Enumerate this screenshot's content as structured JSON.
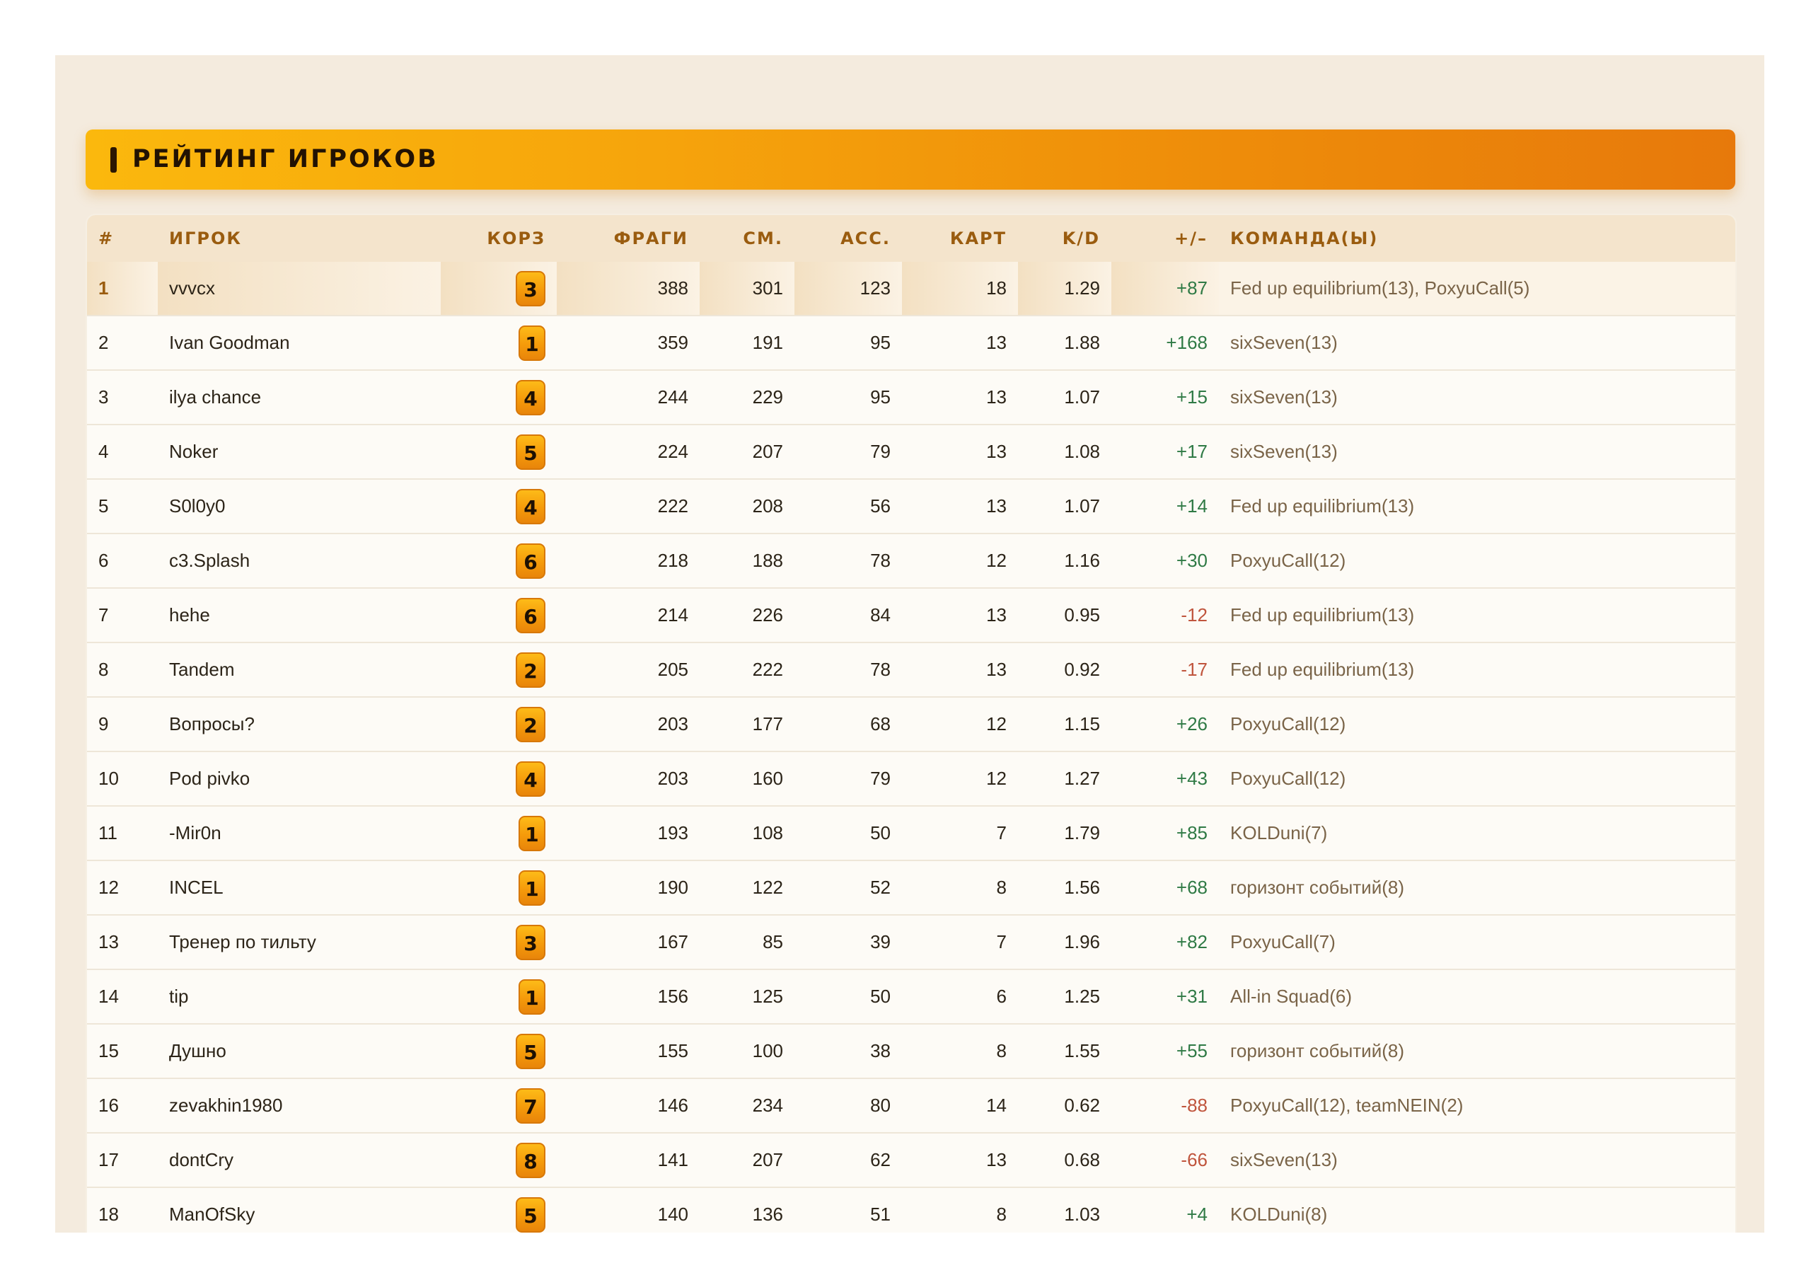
{
  "title": "РЕЙТИНГ ИГРОКОВ",
  "headers": {
    "rank": "#",
    "player": "ИГРОК",
    "basket": "КОРЗ",
    "kills": "ФРАГИ",
    "deaths": "СМ.",
    "assists": "АСС.",
    "maps": "КАРТ",
    "kd": "K/D",
    "diff": "+/–",
    "teams": "КОМАНДА(Ы)"
  },
  "colors": {
    "accent": "#f5a00b",
    "positive": "#2f7a45",
    "negative": "#c0553d",
    "header_text": "#9a5c0f"
  },
  "rows": [
    {
      "rank": "1",
      "player": "vvvcx",
      "basket": "3",
      "kills": "388",
      "deaths": "301",
      "assists": "123",
      "maps": "18",
      "kd": "1.29",
      "diff": "+87",
      "teams": "Fed up equilibrium(13), PoxyuCall(5)"
    },
    {
      "rank": "2",
      "player": "Ivan Goodman",
      "basket": "1",
      "kills": "359",
      "deaths": "191",
      "assists": "95",
      "maps": "13",
      "kd": "1.88",
      "diff": "+168",
      "teams": "sixSeven(13)"
    },
    {
      "rank": "3",
      "player": "ilya chance",
      "basket": "4",
      "kills": "244",
      "deaths": "229",
      "assists": "95",
      "maps": "13",
      "kd": "1.07",
      "diff": "+15",
      "teams": "sixSeven(13)"
    },
    {
      "rank": "4",
      "player": "Noker",
      "basket": "5",
      "kills": "224",
      "deaths": "207",
      "assists": "79",
      "maps": "13",
      "kd": "1.08",
      "diff": "+17",
      "teams": "sixSeven(13)"
    },
    {
      "rank": "5",
      "player": "S0l0y0",
      "basket": "4",
      "kills": "222",
      "deaths": "208",
      "assists": "56",
      "maps": "13",
      "kd": "1.07",
      "diff": "+14",
      "teams": "Fed up equilibrium(13)"
    },
    {
      "rank": "6",
      "player": "c3.Splash",
      "basket": "6",
      "kills": "218",
      "deaths": "188",
      "assists": "78",
      "maps": "12",
      "kd": "1.16",
      "diff": "+30",
      "teams": "PoxyuCall(12)"
    },
    {
      "rank": "7",
      "player": "hehe",
      "basket": "6",
      "kills": "214",
      "deaths": "226",
      "assists": "84",
      "maps": "13",
      "kd": "0.95",
      "diff": "-12",
      "teams": "Fed up equilibrium(13)"
    },
    {
      "rank": "8",
      "player": "Tandem",
      "basket": "2",
      "kills": "205",
      "deaths": "222",
      "assists": "78",
      "maps": "13",
      "kd": "0.92",
      "diff": "-17",
      "teams": "Fed up equilibrium(13)"
    },
    {
      "rank": "9",
      "player": "Вопросы?",
      "basket": "2",
      "kills": "203",
      "deaths": "177",
      "assists": "68",
      "maps": "12",
      "kd": "1.15",
      "diff": "+26",
      "teams": "PoxyuCall(12)"
    },
    {
      "rank": "10",
      "player": "Pod pivko",
      "basket": "4",
      "kills": "203",
      "deaths": "160",
      "assists": "79",
      "maps": "12",
      "kd": "1.27",
      "diff": "+43",
      "teams": "PoxyuCall(12)"
    },
    {
      "rank": "11",
      "player": "-Mir0n",
      "basket": "1",
      "kills": "193",
      "deaths": "108",
      "assists": "50",
      "maps": "7",
      "kd": "1.79",
      "diff": "+85",
      "teams": "KOLDuni(7)"
    },
    {
      "rank": "12",
      "player": "INCEL",
      "basket": "1",
      "kills": "190",
      "deaths": "122",
      "assists": "52",
      "maps": "8",
      "kd": "1.56",
      "diff": "+68",
      "teams": "горизонт событий(8)"
    },
    {
      "rank": "13",
      "player": "Тренер по тильту",
      "basket": "3",
      "kills": "167",
      "deaths": "85",
      "assists": "39",
      "maps": "7",
      "kd": "1.96",
      "diff": "+82",
      "teams": "PoxyuCall(7)"
    },
    {
      "rank": "14",
      "player": "tip",
      "basket": "1",
      "kills": "156",
      "deaths": "125",
      "assists": "50",
      "maps": "6",
      "kd": "1.25",
      "diff": "+31",
      "teams": "All-in Squad(6)"
    },
    {
      "rank": "15",
      "player": "Душно",
      "basket": "5",
      "kills": "155",
      "deaths": "100",
      "assists": "38",
      "maps": "8",
      "kd": "1.55",
      "diff": "+55",
      "teams": "горизонт событий(8)"
    },
    {
      "rank": "16",
      "player": "zevakhin1980",
      "basket": "7",
      "kills": "146",
      "deaths": "234",
      "assists": "80",
      "maps": "14",
      "kd": "0.62",
      "diff": "-88",
      "teams": "PoxyuCall(12), teamNEIN(2)"
    },
    {
      "rank": "17",
      "player": "dontCry",
      "basket": "8",
      "kills": "141",
      "deaths": "207",
      "assists": "62",
      "maps": "13",
      "kd": "0.68",
      "diff": "-66",
      "teams": "sixSeven(13)"
    },
    {
      "rank": "18",
      "player": "ManOfSky",
      "basket": "5",
      "kills": "140",
      "deaths": "136",
      "assists": "51",
      "maps": "8",
      "kd": "1.03",
      "diff": "+4",
      "teams": "KOLDuni(8)"
    }
  ]
}
